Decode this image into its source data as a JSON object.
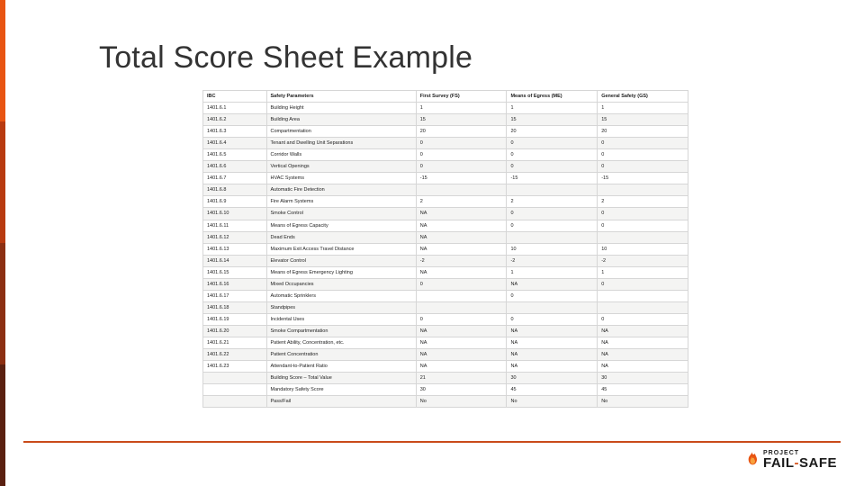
{
  "title": "Total Score Sheet Example",
  "logo": {
    "top": "PROJECT",
    "main_a": "FAIL",
    "dash": "-",
    "main_b": "SAFE"
  },
  "headers": [
    "IBC",
    "Safety Parameters",
    "First Survey (FS)",
    "Means of Egress (ME)",
    "General Safety (GS)"
  ],
  "rows": [
    {
      "ibc": "1401.6.1",
      "param": "Building Height",
      "fs": "1",
      "me": "1",
      "gs": "1"
    },
    {
      "ibc": "1401.6.2",
      "param": "Building Area",
      "fs": "15",
      "me": "15",
      "gs": "15"
    },
    {
      "ibc": "1401.6.3",
      "param": "Compartmentation",
      "fs": "20",
      "me": "20",
      "gs": "20"
    },
    {
      "ibc": "1401.6.4",
      "param": "Tenant and Dwelling Unit Separations",
      "fs": "0",
      "me": "0",
      "gs": "0"
    },
    {
      "ibc": "1401.6.5",
      "param": "Corridor Walls",
      "fs": "0",
      "me": "0",
      "gs": "0"
    },
    {
      "ibc": "1401.6.6",
      "param": "Vertical Openings",
      "fs": "0",
      "me": "0",
      "gs": "0"
    },
    {
      "ibc": "1401.6.7",
      "param": "HVAC Systems",
      "fs": "-15",
      "me": "-15",
      "gs": "-15"
    },
    {
      "ibc": "1401.6.8",
      "param": "Automatic Fire Detection",
      "fs": "",
      "me": "",
      "gs": ""
    },
    {
      "ibc": "1401.6.9",
      "param": "Fire Alarm Systems",
      "fs": "2",
      "me": "2",
      "gs": "2"
    },
    {
      "ibc": "1401.6.10",
      "param": "Smoke Control",
      "fs": "NA",
      "me": "0",
      "gs": "0"
    },
    {
      "ibc": "1401.6.11",
      "param": "Means of Egress Capacity",
      "fs": "NA",
      "me": "0",
      "gs": "0"
    },
    {
      "ibc": "1401.6.12",
      "param": "Dead Ends",
      "fs": "NA",
      "me": "",
      "gs": ""
    },
    {
      "ibc": "1401.6.13",
      "param": "Maximum Exit Access Travel Distance",
      "fs": "NA",
      "me": "10",
      "gs": "10"
    },
    {
      "ibc": "1401.6.14",
      "param": "Elevator Control",
      "fs": "-2",
      "me": "-2",
      "gs": "-2"
    },
    {
      "ibc": "1401.6.15",
      "param": "Means of Egress Emergency Lighting",
      "fs": "NA",
      "me": "1",
      "gs": "1"
    },
    {
      "ibc": "1401.6.16",
      "param": "Mixed Occupancies",
      "fs": "0",
      "me": "NA",
      "gs": "0"
    },
    {
      "ibc": "1401.6.17",
      "param": "Automatic Sprinklers",
      "fs": "",
      "me": "0",
      "gs": ""
    },
    {
      "ibc": "1401.6.18",
      "param": "Standpipes",
      "fs": "",
      "me": "",
      "gs": ""
    },
    {
      "ibc": "1401.6.19",
      "param": "Incidental Uses",
      "fs": "0",
      "me": "0",
      "gs": "0"
    },
    {
      "ibc": "1401.6.20",
      "param": "Smoke Compartmentation",
      "fs": "NA",
      "me": "NA",
      "gs": "NA"
    },
    {
      "ibc": "1401.6.21",
      "param": "Patient Ability, Concentration, etc.",
      "fs": "NA",
      "me": "NA",
      "gs": "NA"
    },
    {
      "ibc": "1401.6.22",
      "param": "Patient Concentration",
      "fs": "NA",
      "me": "NA",
      "gs": "NA"
    },
    {
      "ibc": "1401.6.23",
      "param": "Attendant-to-Patient Ratio",
      "fs": "NA",
      "me": "NA",
      "gs": "NA"
    }
  ],
  "summary": [
    {
      "param": "Building Score – Total Value",
      "fs": "21",
      "me": "30",
      "gs": "30"
    },
    {
      "param": "Mandatory Safety Score",
      "fs": "30",
      "me": "45",
      "gs": "45"
    },
    {
      "param": "Pass/Fail",
      "fs": "No",
      "me": "No",
      "gs": "No"
    }
  ]
}
